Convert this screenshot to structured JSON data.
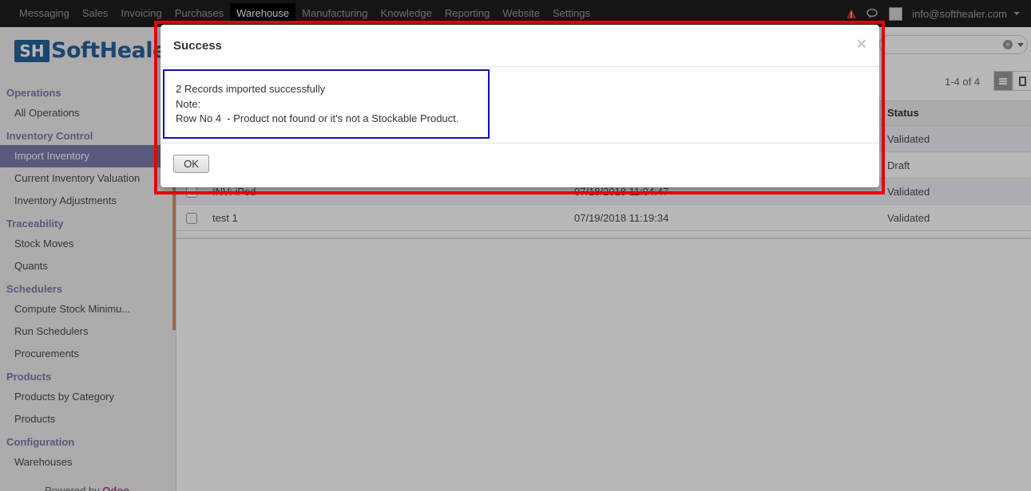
{
  "topbar": {
    "menu": [
      "Messaging",
      "Sales",
      "Invoicing",
      "Purchases",
      "Warehouse",
      "Manufacturing",
      "Knowledge",
      "Reporting",
      "Website",
      "Settings"
    ],
    "active_menu": "Warehouse",
    "user_email": "info@softhealer.com"
  },
  "logo": {
    "mark": "SH",
    "text": "SoftHealer"
  },
  "sidebar": {
    "sections": [
      {
        "title": "Operations",
        "items": [
          "All Operations"
        ]
      },
      {
        "title": "Inventory Control",
        "items": [
          "Import Inventory",
          "Current Inventory Valuation",
          "Inventory Adjustments"
        ]
      },
      {
        "title": "Traceability",
        "items": [
          "Stock Moves",
          "Quants"
        ]
      },
      {
        "title": "Schedulers",
        "items": [
          "Compute Stock Minimu...",
          "Run Schedulers",
          "Procurements"
        ]
      },
      {
        "title": "Products",
        "items": [
          "Products by Category",
          "Products"
        ]
      },
      {
        "title": "Configuration",
        "items": [
          "Warehouses"
        ]
      }
    ],
    "active_item": "Import Inventory",
    "powered_by": "Powered by",
    "powered_brand": "Odoo"
  },
  "list": {
    "pager": "1-4 of 4",
    "status_header": "Status",
    "rows": [
      {
        "ref": "",
        "date": "",
        "status": "Validated"
      },
      {
        "ref": "",
        "date": "",
        "status": "Draft"
      },
      {
        "ref": "INV: iPod",
        "date": "07/18/2018 11:04:47",
        "status": "Validated"
      },
      {
        "ref": "test 1",
        "date": "07/19/2018 11:19:34",
        "status": "Validated"
      }
    ]
  },
  "dialog": {
    "title": "Success",
    "close": "×",
    "lines": [
      "2 Records imported successfully",
      "Note:",
      "Row No 4  - Product not found or it's not a Stockable Product."
    ],
    "ok_label": "OK"
  },
  "colors": {
    "highlight": "#ee0000",
    "message_border": "#1212a8",
    "sidebar_accent": "#7c7bad"
  }
}
